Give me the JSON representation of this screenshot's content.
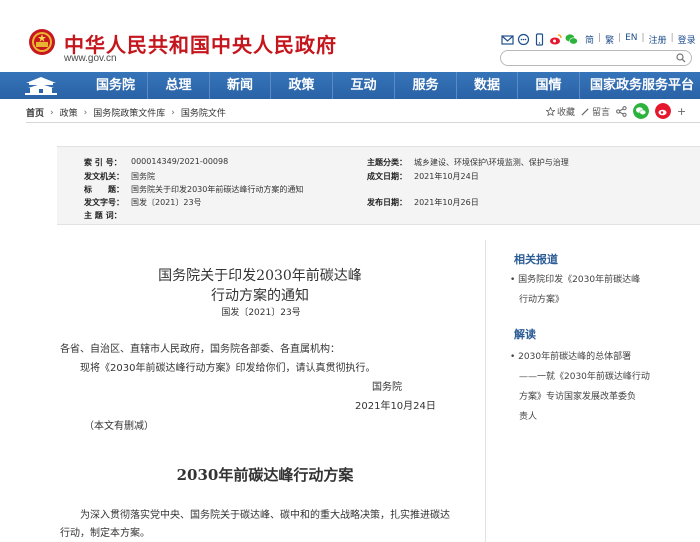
{
  "header": {
    "site_title": "中华人民共和国中央人民政府",
    "site_url": "www.gov.cn",
    "links": [
      "简",
      "繁",
      "EN",
      "注册",
      "登录"
    ],
    "icons": [
      "email-icon",
      "comment-icon",
      "mobile-icon",
      "weibo-icon",
      "wechat-icon"
    ],
    "search_placeholder": ""
  },
  "nav": {
    "items": [
      "国务院",
      "总理",
      "新闻",
      "政策",
      "互动",
      "服务",
      "数据",
      "国情",
      "国家政务服务平台"
    ]
  },
  "breadcrumb": [
    "首页",
    "政策",
    "国务院政策文件库",
    "国务院文件"
  ],
  "tools": {
    "favorite": "收藏",
    "comment": "留言"
  },
  "meta": {
    "index_no_label": "索 引 号：",
    "index_no": "000014349/2021-00098",
    "issuer_label": "发文机关：",
    "issuer": "国务院",
    "title_label": "标　　题：",
    "title": "国务院关于印发2030年前碳达峰行动方案的通知",
    "doc_no_label": "发文字号：",
    "doc_no": "国发〔2021〕23号",
    "subject_label": "主 题 词：",
    "subject": "",
    "category_label": "主题分类：",
    "category": "城乡建设、环境保护\\环境监测、保护与治理",
    "date_created_label": "成文日期：",
    "date_created": "2021年10月24日",
    "date_published_label": "发布日期：",
    "date_published": "2021年10月26日"
  },
  "article": {
    "title_line1": "国务院关于印发2030年前碳达峰",
    "title_line2": "行动方案的通知",
    "doc_no": "国发〔2021〕23号",
    "addressee": "各省、自治区、直辖市人民政府，国务院各部委、各直属机构：",
    "body": "现将《2030年前碳达峰行动方案》印发给你们，请认真贯彻执行。",
    "signature": "国务院",
    "date": "2021年10月24日",
    "note": "（本文有删减）",
    "plan_title": "2030年前碳达峰行动方案",
    "plan_intro_line1": "为深入贯彻落实党中央、国务院关于碳达峰、碳中和的重大战略决策，扎实推进碳达",
    "plan_intro_line2": "行动，制定本方案。"
  },
  "sidebar": {
    "related_title": "相关报道",
    "related_item_line1": "国务院印发《2030年前碳达峰",
    "related_item_line2": "行动方案》",
    "interpret_title": "解读",
    "interpret_item_line1": "2030年前碳达峰的总体部署",
    "interpret_item_line2": "——一就《2030年前碳达峰行动",
    "interpret_item_line3": "方案》专访国家发展改革委负",
    "interpret_item_line4": "责人"
  },
  "colors": {
    "brand_red": "#c4161c",
    "nav_blue": "#2a62a6",
    "link_blue": "#2c5c96"
  }
}
